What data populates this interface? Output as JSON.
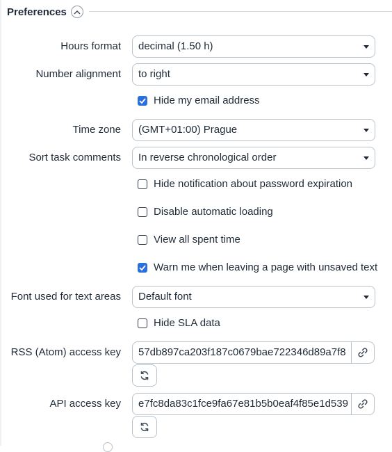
{
  "section": {
    "title": "Preferences"
  },
  "fields": {
    "hours_format": {
      "label": "Hours format",
      "value": "decimal (1.50 h)"
    },
    "number_alignment": {
      "label": "Number alignment",
      "value": "to right"
    },
    "time_zone": {
      "label": "Time zone",
      "value": "(GMT+01:00) Prague"
    },
    "sort_task_comments": {
      "label": "Sort task comments",
      "value": "In reverse chronological order"
    },
    "font_text_areas": {
      "label": "Font used for text areas",
      "value": "Default font"
    }
  },
  "checkboxes": {
    "hide_email": {
      "label": "Hide my email address",
      "checked": true
    },
    "hide_password_notification": {
      "label": "Hide notification about password expiration",
      "checked": false
    },
    "disable_auto_loading": {
      "label": "Disable automatic loading",
      "checked": false
    },
    "view_all_spent_time": {
      "label": "View all spent time",
      "checked": false
    },
    "warn_unsaved_text": {
      "label": "Warn me when leaving a page with unsaved text",
      "checked": true
    },
    "hide_sla_data": {
      "label": "Hide SLA data",
      "checked": false
    }
  },
  "keys": {
    "rss": {
      "label": "RSS (Atom) access key",
      "value": "57db897ca203f187c0679bae722346d89a7f8"
    },
    "api": {
      "label": "API access key",
      "value": "e7fc8da83c1fce9fa67e81b5b0eaf4f85e1d539"
    }
  },
  "colors": {
    "accent": "#2a6fdb",
    "border": "#b9c3cc",
    "text": "#1f2a37"
  }
}
